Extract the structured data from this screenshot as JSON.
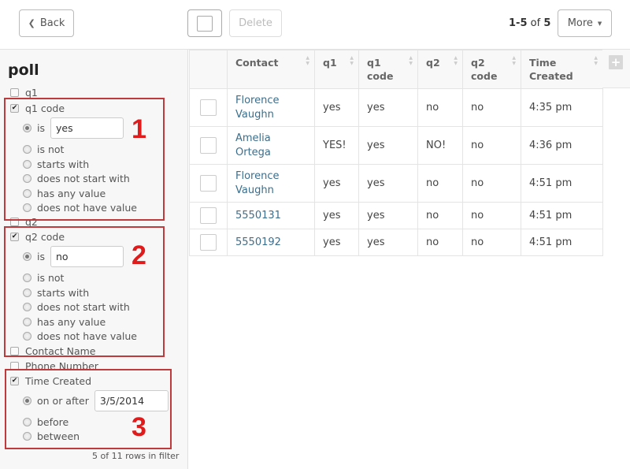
{
  "toolbar": {
    "back_label": "Back",
    "delete_label": "Delete",
    "pager": {
      "range": "1-5",
      "of_word": "of",
      "total": "5"
    },
    "more_label": "More",
    "icons": {
      "back": "chevron-left-icon",
      "more": "caret-down-icon"
    }
  },
  "sidebar": {
    "title": "poll",
    "fields": {
      "q1": {
        "label": "q1",
        "checked": false
      },
      "q1_code": {
        "label": "q1 code",
        "checked": true,
        "options": [
          "is",
          "is not",
          "starts with",
          "does not start with",
          "has any value",
          "does not have value"
        ],
        "selected": "is",
        "value": "yes"
      },
      "q2": {
        "label": "q2",
        "checked": false
      },
      "q2_code": {
        "label": "q2 code",
        "checked": true,
        "options": [
          "is",
          "is not",
          "starts with",
          "does not start with",
          "has any value",
          "does not have value"
        ],
        "selected": "is",
        "value": "no"
      },
      "contact_name": {
        "label": "Contact Name",
        "checked": false
      },
      "phone_number": {
        "label": "Phone Number",
        "checked": false
      },
      "time_created": {
        "label": "Time Created",
        "checked": true,
        "options": [
          "on or after",
          "before",
          "between"
        ],
        "selected": "on or after",
        "value": "3/5/2014"
      }
    },
    "filter_count": "5 of 11 rows in filter"
  },
  "annotations": {
    "box1": "1",
    "box2": "2",
    "box3": "3",
    "color": "#e01b1b"
  },
  "table": {
    "columns": [
      {
        "label": "Contact",
        "sortable": true
      },
      {
        "label": "q1",
        "sortable": true
      },
      {
        "label": "q1 code",
        "sortable": true
      },
      {
        "label": "q2",
        "sortable": true
      },
      {
        "label": "q2 code",
        "sortable": true
      },
      {
        "label": "Time Created",
        "sortable": true
      }
    ],
    "rows": [
      {
        "contact": "Florence Vaughn",
        "q1": "yes",
        "q1_code": "yes",
        "q2": "no",
        "q2_code": "no",
        "time": "4:35 pm"
      },
      {
        "contact": "Amelia Ortega",
        "q1": "YES!",
        "q1_code": "yes",
        "q2": "NO!",
        "q2_code": "no",
        "time": "4:36 pm"
      },
      {
        "contact": "Florence Vaughn",
        "q1": "yes",
        "q1_code": "yes",
        "q2": "no",
        "q2_code": "no",
        "time": "4:51 pm"
      },
      {
        "contact": "5550131",
        "q1": "yes",
        "q1_code": "yes",
        "q2": "no",
        "q2_code": "no",
        "time": "4:51 pm"
      },
      {
        "contact": "5550192",
        "q1": "yes",
        "q1_code": "yes",
        "q2": "no",
        "q2_code": "no",
        "time": "4:51 pm"
      }
    ],
    "add_column_icon": "plus-icon",
    "link_color": "#3c6e8c"
  }
}
